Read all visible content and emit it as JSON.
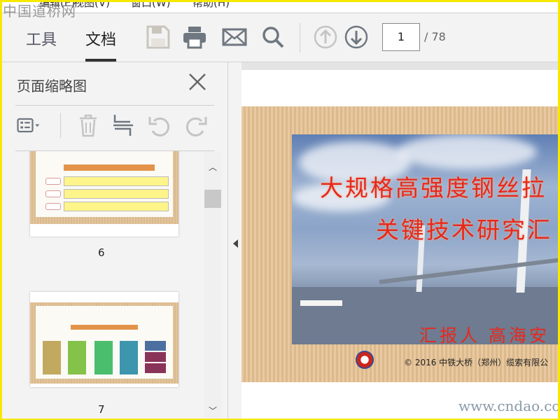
{
  "watermark_top": "中国道桥网",
  "watermark_bottom": "www.cndao.com",
  "menu": [
    "编辑(E)",
    "视图(V)",
    "窗口(W)",
    "帮助(H)"
  ],
  "tabs": [
    {
      "label": "工具"
    },
    {
      "label": "文档",
      "active": true
    }
  ],
  "toolbar": {
    "current_page": "1",
    "total_pages": "/ 78"
  },
  "panel": {
    "title": "页面缩略图"
  },
  "thumbnails": [
    {
      "label": "6"
    },
    {
      "label": "7"
    }
  ],
  "slide": {
    "title_line1": "大规格高强度钢丝拉",
    "title_line2": "关键技术研究汇",
    "reporter": "汇报人  高海安",
    "copyright": "©  2016  中铁大桥（郑州）缆索有限公"
  },
  "colors": {
    "accent": "#e8281c",
    "frame": "#f6e800"
  }
}
